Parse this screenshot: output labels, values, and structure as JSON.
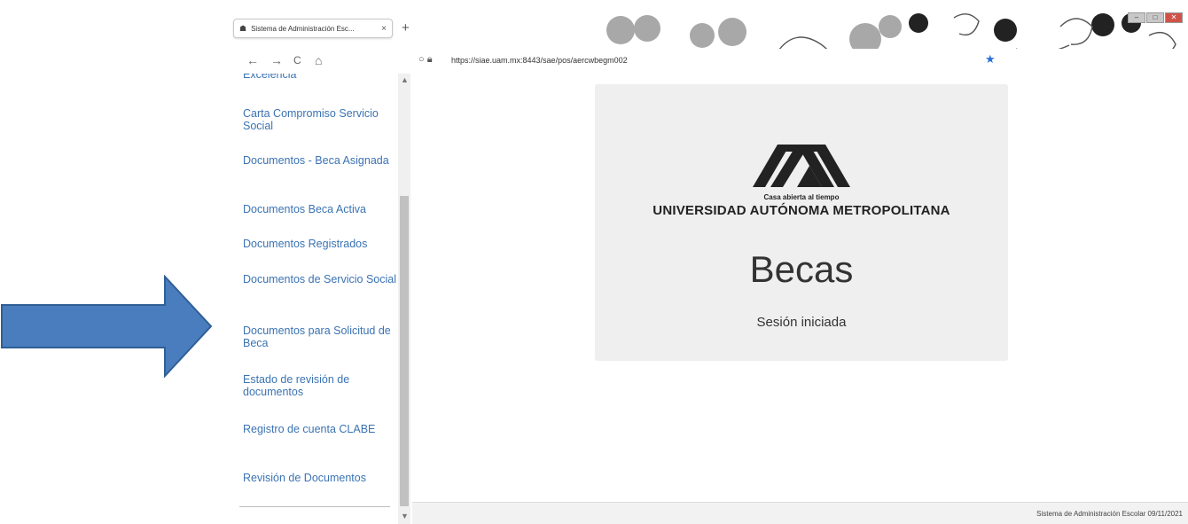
{
  "browser": {
    "tab_title": "Sistema de Administración Esc...",
    "tab_close": "×",
    "new_tab": "+",
    "back": "←",
    "forward": "→",
    "reload": "C",
    "home": "⌂",
    "url": "https://siae.uam.mx:8443/sae/pos/aercwbegm002",
    "star": "★"
  },
  "sidebar": {
    "items": [
      {
        "label": "Excelencia"
      },
      {
        "label": "Carta Compromiso Servicio Social"
      },
      {
        "label": "Documentos - Beca Asignada"
      },
      {
        "label": "Documentos Beca Activa"
      },
      {
        "label": "Documentos Registrados"
      },
      {
        "label": "Documentos de Servicio Social"
      },
      {
        "label": "Documentos para Solicitud de Beca"
      },
      {
        "label": "Estado de revisión de documentos"
      },
      {
        "label": "Registro de cuenta CLABE"
      },
      {
        "label": "Revisión de Documentos"
      }
    ]
  },
  "card": {
    "tagline": "Casa abierta al tiempo",
    "university": "UNIVERSIDAD AUTÓNOMA METROPOLITANA",
    "title": "Becas",
    "status": "Sesión iniciada"
  },
  "footer": {
    "text": "Sistema de Administración Escolar 09/11/2021"
  },
  "colors": {
    "link": "#3b73b3",
    "arrow": "#4a7dbd",
    "card_bg": "#efefef"
  }
}
